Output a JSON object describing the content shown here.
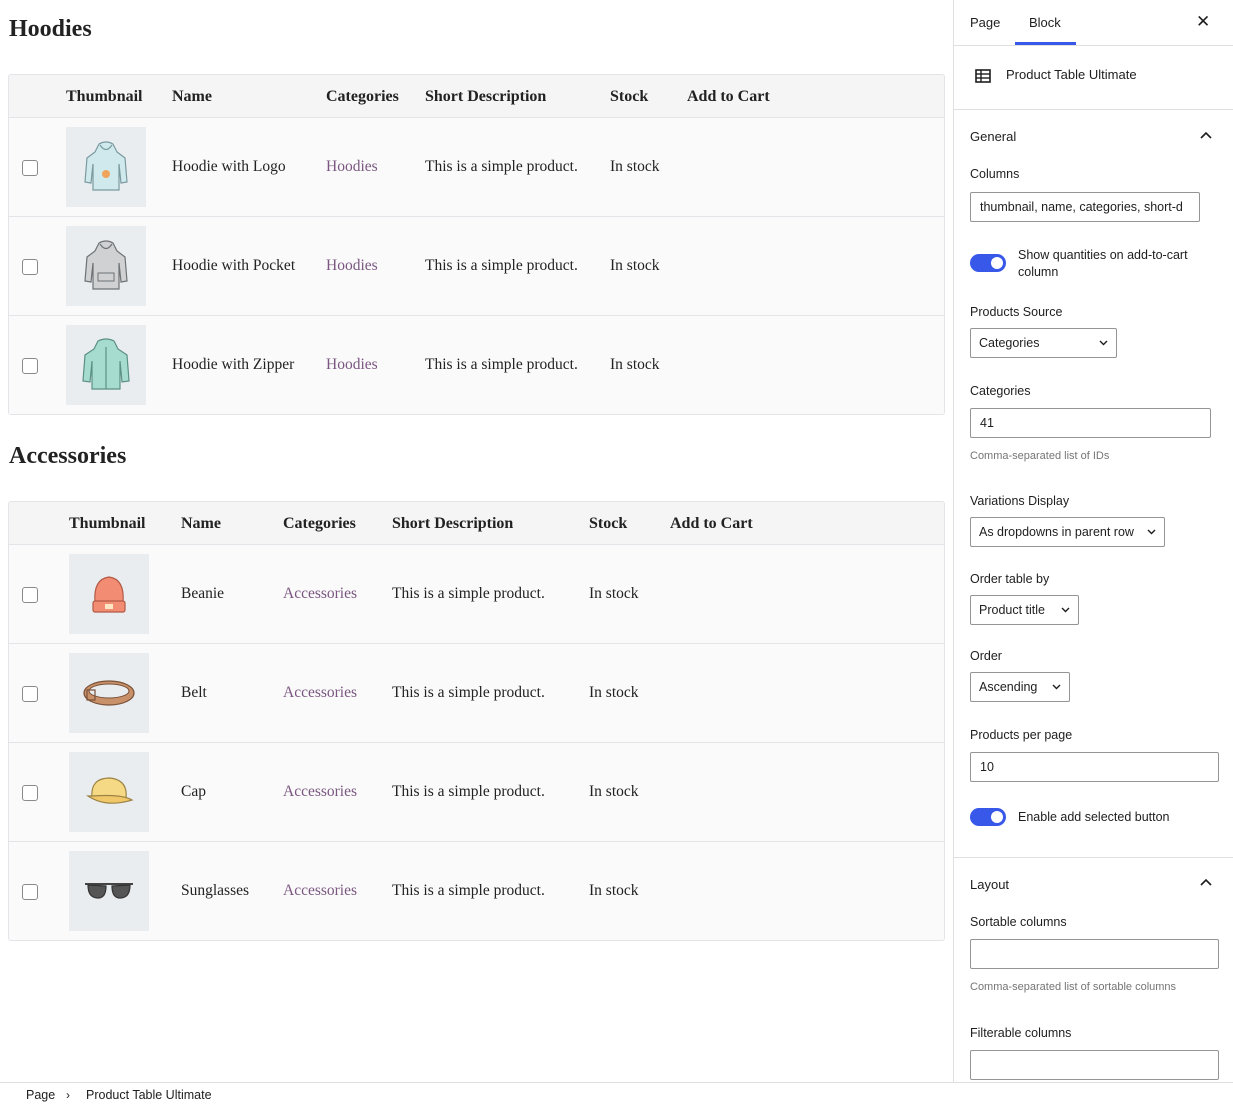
{
  "canvas": {
    "sections": [
      {
        "title": "Hoodies",
        "headers": [
          "Thumbnail",
          "Name",
          "Categories",
          "Short Description",
          "Stock",
          "Add to Cart"
        ],
        "rows": [
          {
            "thumb_icon": "hoodie-logo-icon",
            "name": "Hoodie with Logo",
            "category": "Hoodies",
            "description": "This is a simple product.",
            "stock": "In stock"
          },
          {
            "thumb_icon": "hoodie-pocket-icon",
            "name": "Hoodie with Pocket",
            "category": "Hoodies",
            "description": "This is a simple product.",
            "stock": "In stock"
          },
          {
            "thumb_icon": "hoodie-zipper-icon",
            "name": "Hoodie with Zipper",
            "category": "Hoodies",
            "description": "This is a simple product.",
            "stock": "In stock"
          }
        ]
      },
      {
        "title": "Accessories",
        "headers": [
          "Thumbnail",
          "Name",
          "Categories",
          "Short Description",
          "Stock",
          "Add to Cart"
        ],
        "rows": [
          {
            "thumb_icon": "beanie-icon",
            "name": "Beanie",
            "category": "Accessories",
            "description": "This is a simple product.",
            "stock": "In stock"
          },
          {
            "thumb_icon": "belt-icon",
            "name": "Belt",
            "category": "Accessories",
            "description": "This is a simple product.",
            "stock": "In stock"
          },
          {
            "thumb_icon": "cap-icon",
            "name": "Cap",
            "category": "Accessories",
            "description": "This is a simple product.",
            "stock": "In stock"
          },
          {
            "thumb_icon": "sunglasses-icon",
            "name": "Sunglasses",
            "category": "Accessories",
            "description": "This is a simple product.",
            "stock": "In stock"
          }
        ]
      }
    ]
  },
  "sidebar": {
    "tabs": {
      "page": "Page",
      "block": "Block",
      "active": "Block"
    },
    "close_icon": "close-icon",
    "block": {
      "icon": "table-icon",
      "title": "Product Table Ultimate"
    },
    "general": {
      "title": "General",
      "columns_label": "Columns",
      "columns_value": "thumbnail, name, categories, short-d",
      "show_quantities_label": "Show quantities on add-to-cart column",
      "show_quantities_on": true,
      "products_source_label": "Products Source",
      "products_source_value": "Categories",
      "categories_label": "Categories",
      "categories_value": "41",
      "categories_help": "Comma-separated list of IDs",
      "variations_label": "Variations Display",
      "variations_value": "As dropdowns in parent row",
      "order_by_label": "Order table by",
      "order_by_value": "Product title",
      "order_label": "Order",
      "order_value": "Ascending",
      "per_page_label": "Products per page",
      "per_page_value": "10",
      "add_selected_label": "Enable add selected button",
      "add_selected_on": true
    },
    "layout": {
      "title": "Layout",
      "sortable_label": "Sortable columns",
      "sortable_value": "",
      "sortable_help": "Comma-separated list of sortable columns",
      "filterable_label": "Filterable columns",
      "filterable_value": ""
    }
  },
  "footer": {
    "crumbs": [
      "Page",
      "Product Table Ultimate"
    ]
  },
  "colors": {
    "accent": "#3858e9",
    "category_link": "#7a5680",
    "thumb_bg": "#e9edf0"
  }
}
